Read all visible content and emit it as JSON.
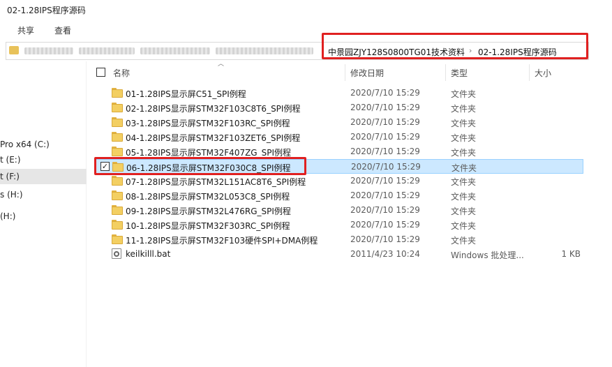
{
  "window": {
    "title": "02-1.28IPS程序源码"
  },
  "ribbon": {
    "tabs": [
      "共享",
      "查看"
    ]
  },
  "address": {
    "crumbs": [
      "中景园ZJY128S0800TG01技术资料",
      "02-1.28IPS程序源码"
    ],
    "separator": "›"
  },
  "nav": {
    "items": [
      {
        "label": "Pro x64 (C:)",
        "selected": false
      },
      {
        "label": "t (E:)",
        "selected": false
      },
      {
        "label": "t (F:)",
        "selected": true
      },
      {
        "label": "s (H:)",
        "selected": false
      },
      {
        "label": "(H:)",
        "selected": false
      }
    ]
  },
  "columns": {
    "name": "名称",
    "date": "修改日期",
    "type": "类型",
    "size": "大小"
  },
  "files": [
    {
      "name": "01-1.28IPS显示屏C51_SPI例程",
      "date": "2020/7/10 15:29",
      "type": "文件夹",
      "size": "",
      "kind": "folder",
      "selected": false
    },
    {
      "name": "02-1.28IPS显示屏STM32F103C8T6_SPI例程",
      "date": "2020/7/10 15:29",
      "type": "文件夹",
      "size": "",
      "kind": "folder",
      "selected": false
    },
    {
      "name": "03-1.28IPS显示屏STM32F103RC_SPI例程",
      "date": "2020/7/10 15:29",
      "type": "文件夹",
      "size": "",
      "kind": "folder",
      "selected": false
    },
    {
      "name": "04-1.28IPS显示屏STM32F103ZET6_SPI例程",
      "date": "2020/7/10 15:29",
      "type": "文件夹",
      "size": "",
      "kind": "folder",
      "selected": false
    },
    {
      "name": "05-1.28IPS显示屏STM32F407ZG_SPI例程",
      "date": "2020/7/10 15:29",
      "type": "文件夹",
      "size": "",
      "kind": "folder",
      "selected": false
    },
    {
      "name": "06-1.28IPS显示屏STM32F030C8_SPI例程",
      "date": "2020/7/10 15:29",
      "type": "文件夹",
      "size": "",
      "kind": "folder",
      "selected": true
    },
    {
      "name": "07-1.28IPS显示屏STM32L151AC8T6_SPI例程",
      "date": "2020/7/10 15:29",
      "type": "文件夹",
      "size": "",
      "kind": "folder",
      "selected": false
    },
    {
      "name": "08-1.28IPS显示屏STM32L053C8_SPI例程",
      "date": "2020/7/10 15:29",
      "type": "文件夹",
      "size": "",
      "kind": "folder",
      "selected": false
    },
    {
      "name": "09-1.28IPS显示屏STM32L476RG_SPI例程",
      "date": "2020/7/10 15:29",
      "type": "文件夹",
      "size": "",
      "kind": "folder",
      "selected": false
    },
    {
      "name": "10-1.28IPS显示屏STM32F303RC_SPI例程",
      "date": "2020/7/10 15:29",
      "type": "文件夹",
      "size": "",
      "kind": "folder",
      "selected": false
    },
    {
      "name": "11-1.28IPS显示屏STM32F103硬件SPI+DMA例程",
      "date": "2020/7/10 15:29",
      "type": "文件夹",
      "size": "",
      "kind": "folder",
      "selected": false
    },
    {
      "name": "keilkilll.bat",
      "date": "2011/4/23 10:24",
      "type": "Windows 批处理...",
      "size": "1 KB",
      "kind": "bat",
      "selected": false
    }
  ],
  "selection": {
    "check_mark": "✓"
  },
  "colors": {
    "highlight": "#e02020",
    "selected_row": "#cce8ff",
    "folder": "#f3cf62"
  }
}
